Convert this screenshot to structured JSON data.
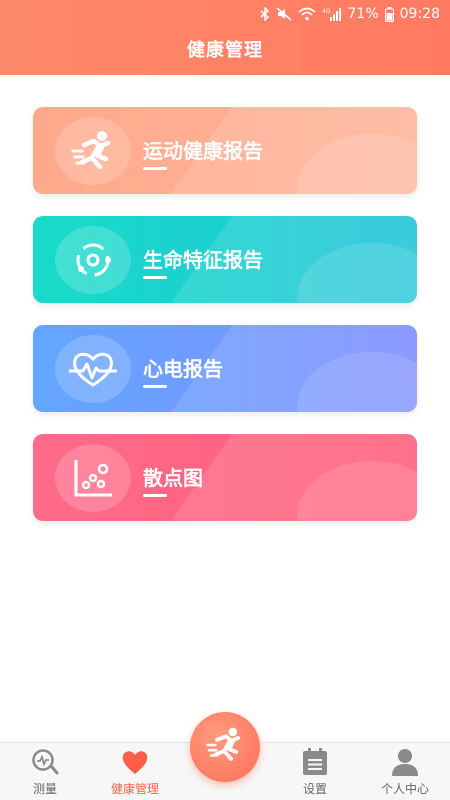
{
  "status_bar": {
    "battery": "71%",
    "time": "09:28",
    "network": "4G"
  },
  "header": {
    "title": "健康管理"
  },
  "cards": [
    {
      "label": "运动健康报告",
      "icon": "running-person-icon"
    },
    {
      "label": "生命特征报告",
      "icon": "vital-signs-icon"
    },
    {
      "label": "心电报告",
      "icon": "heart-pulse-icon"
    },
    {
      "label": "散点图",
      "icon": "scatter-plot-icon"
    }
  ],
  "bottom_nav": {
    "items": [
      {
        "label": "测量",
        "icon": "measure-icon",
        "active": false
      },
      {
        "label": "健康管理",
        "icon": "heart-icon",
        "active": true
      },
      {
        "label": "设置",
        "icon": "calendar-settings-icon",
        "active": false
      },
      {
        "label": "个人中心",
        "icon": "user-icon",
        "active": false
      }
    ],
    "center_icon": "running-person-icon"
  },
  "colors": {
    "header": "#ff7f63",
    "card1": "#ffae92",
    "card2": "#1bd2cf",
    "card3": "#6f9aff",
    "card4": "#ff6582",
    "nav_active": "#ff5f4a"
  }
}
